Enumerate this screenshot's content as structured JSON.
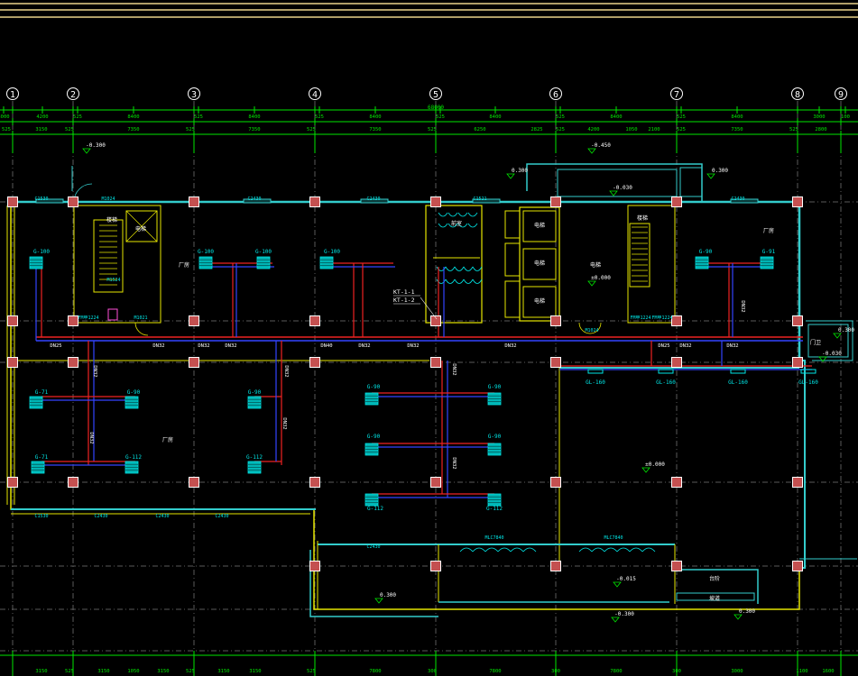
{
  "colors": {
    "background": "#000000",
    "axis": "#ffffff",
    "grid": "#5a5a5a",
    "dim": "#00e600",
    "wall": "#e6e600",
    "cyan": "#33cccc",
    "pipe_supply": "#ee2222",
    "pipe_return": "#3344ff",
    "column_fill": "#c45050",
    "column_stroke": "#ffffff",
    "unit_fill": "#00b4b4",
    "label_cyan": "#00e6e6",
    "text_white": "#ffffff",
    "top_border": "#e6c76a"
  },
  "axes": {
    "labels": [
      "1",
      "2",
      "3",
      "4",
      "5",
      "6",
      "7",
      "8",
      "9"
    ]
  },
  "dimensions": {
    "overall": "68000",
    "row1": [
      "3000",
      "4200",
      "525",
      "8400",
      "525",
      "8400",
      "525",
      "8400",
      "525",
      "8400",
      "525",
      "8400",
      "525",
      "8400",
      "3000",
      "100"
    ],
    "row2": [
      "525",
      "3150",
      "525",
      "7350",
      "525",
      "7350",
      "525",
      "7350",
      "525",
      "6250",
      "2825",
      "525",
      "4200",
      "1050",
      "2100",
      "525",
      "7350",
      "525",
      "2800"
    ],
    "bottom": [
      "3150",
      "525",
      "3150",
      "1050",
      "3150",
      "525",
      "3150",
      "3150",
      "525",
      "7800",
      "300",
      "7800",
      "300",
      "7800",
      "300",
      "3000",
      "1100",
      "1600"
    ]
  },
  "levels": [
    "-0.300",
    "-0.450",
    "-0.030",
    "±0.000",
    "±0.000",
    "-0.015",
    "-0.300",
    "0.300",
    "0.300",
    "0.300",
    "-0.030",
    "0.300",
    "0.300"
  ],
  "equipment": {
    "units": [
      "G-100",
      "G-100",
      "G-100",
      "G-100",
      "G-90",
      "G-91",
      "G-71",
      "G-90",
      "G-90",
      "G-71",
      "G-112",
      "G-112",
      "G-90",
      "G-90",
      "G-90",
      "G-90",
      "G-112",
      "G-112"
    ],
    "grilles": [
      "GL-160",
      "GL-160",
      "GL-160",
      "GL-160"
    ],
    "riser_tags": [
      "KT-1-1",
      "KT-1-2"
    ]
  },
  "pipe_labels": [
    "DN25",
    "DN32",
    "DN32",
    "DN32",
    "DN32",
    "DN40",
    "DN32",
    "DN32",
    "DN32",
    "DN32",
    "DN25",
    "DN32",
    "DN32",
    "DN32",
    "DN32",
    "DN32",
    "DN32",
    "DN32"
  ],
  "room_labels": [
    "厂房",
    "厂房",
    "厂房",
    "电梯",
    "电梯",
    "电梯",
    "电梯",
    "电梯",
    "前室",
    "楼梯",
    "楼梯",
    "门卫",
    "台阶",
    "坡道"
  ],
  "door_labels": [
    "M1024",
    "M1524",
    "FM甲1224",
    "M1021",
    "C1530",
    "C2430",
    "C2430",
    "C1521",
    "C2430",
    "C1530",
    "C2430",
    "C2430",
    "C2430",
    "MLC7840",
    "MLC7840",
    "C2430",
    "FM甲1224",
    "FM甲1224",
    "M1024"
  ]
}
